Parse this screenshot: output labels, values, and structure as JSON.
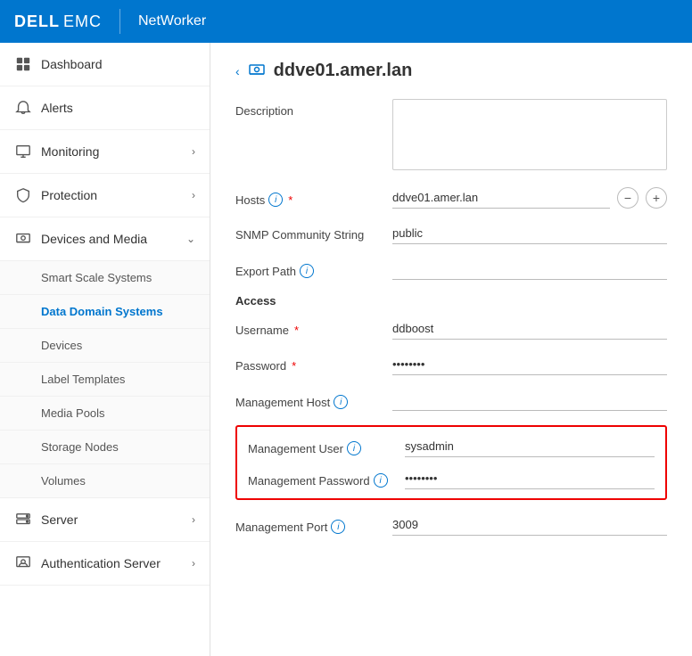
{
  "app": {
    "brand_dell": "DELL",
    "brand_emc": "EMC",
    "brand_app": "NetWorker"
  },
  "sidebar": {
    "items": [
      {
        "id": "dashboard",
        "label": "Dashboard",
        "has_arrow": false,
        "icon": "dashboard-icon"
      },
      {
        "id": "alerts",
        "label": "Alerts",
        "has_arrow": false,
        "icon": "alerts-icon"
      },
      {
        "id": "monitoring",
        "label": "Monitoring",
        "has_arrow": true,
        "icon": "monitoring-icon"
      },
      {
        "id": "protection",
        "label": "Protection",
        "has_arrow": true,
        "icon": "protection-icon"
      },
      {
        "id": "devices-and-media",
        "label": "Devices and Media",
        "has_arrow": true,
        "expanded": true,
        "icon": "devices-media-icon"
      }
    ],
    "subitems": [
      {
        "id": "smart-scale",
        "label": "Smart Scale Systems",
        "active": false
      },
      {
        "id": "data-domain",
        "label": "Data Domain Systems",
        "active": true
      },
      {
        "id": "devices",
        "label": "Devices",
        "active": false
      },
      {
        "id": "label-templates",
        "label": "Label Templates",
        "active": false
      },
      {
        "id": "media-pools",
        "label": "Media Pools",
        "active": false
      },
      {
        "id": "storage-nodes",
        "label": "Storage Nodes",
        "active": false
      },
      {
        "id": "volumes",
        "label": "Volumes",
        "active": false
      }
    ],
    "bottom_items": [
      {
        "id": "server",
        "label": "Server",
        "has_arrow": true,
        "icon": "server-icon"
      },
      {
        "id": "auth-server",
        "label": "Authentication Server",
        "has_arrow": true,
        "icon": "auth-icon"
      }
    ]
  },
  "content": {
    "breadcrumb_back": "<",
    "page_icon": "domain-icon",
    "page_title": "ddve01.amer.lan",
    "fields": {
      "description_label": "Description",
      "description_value": "",
      "description_placeholder": "",
      "hosts_label": "Hosts",
      "hosts_required": "*",
      "hosts_value": "ddve01.amer.lan",
      "snmp_label": "SNMP Community String",
      "snmp_value": "public",
      "export_path_label": "Export Path",
      "export_path_value": "",
      "access_heading": "Access",
      "username_label": "Username",
      "username_required": "*",
      "username_value": "ddboost",
      "password_label": "Password",
      "password_required": "*",
      "password_value": "·······",
      "mgmt_host_label": "Management Host",
      "mgmt_host_value": "",
      "mgmt_user_label": "Management User",
      "mgmt_user_value": "sysadmin",
      "mgmt_password_label": "Management Password",
      "mgmt_password_value": "·······",
      "mgmt_port_label": "Management Port",
      "mgmt_port_value": "3009"
    }
  }
}
